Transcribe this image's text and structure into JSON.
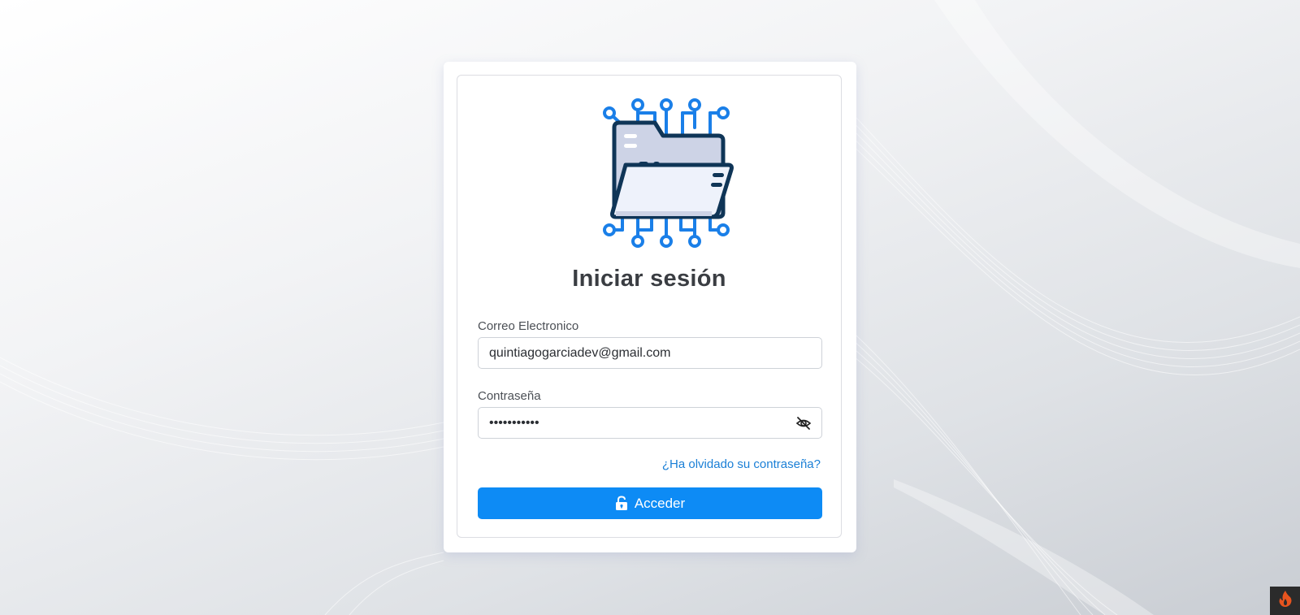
{
  "login": {
    "title": "Iniciar sesión",
    "email_label": "Correo Electronico",
    "email_value": "quintiagogarciadev@gmail.com",
    "password_label": "Contraseña",
    "password_value": "passwordabc",
    "forgot_link": "¿Ha olvidado su contraseña?",
    "submit_label": "Acceder"
  },
  "icons": {
    "logo": "folder-circuit-logo",
    "password_toggle": "eye-slash-icon",
    "submit": "unlock-icon",
    "corner_badge": "flame-icon"
  },
  "colors": {
    "primary": "#0d8bf5",
    "link": "#1a7fd6",
    "logo_blue": "#1a7fe8",
    "logo_navy": "#0f3557",
    "badge_flame": "#e8541e"
  }
}
